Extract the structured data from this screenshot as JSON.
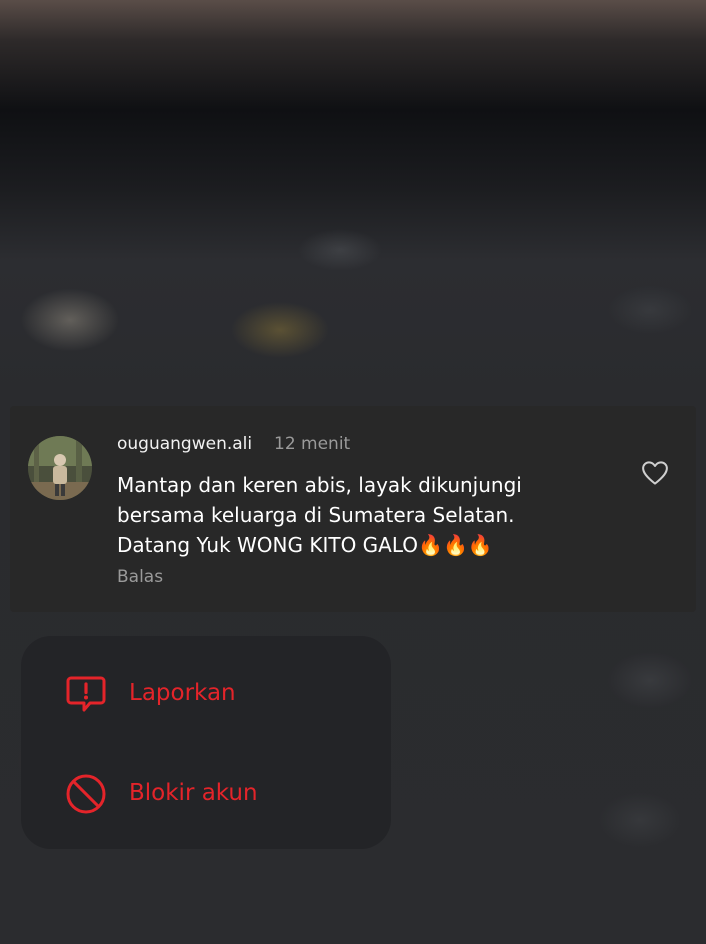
{
  "comment": {
    "username": "ouguangwen.ali",
    "time": "12 menit",
    "text_lines": [
      "Mantap dan keren abis, layak dikunjungi",
      "bersama keluarga di Sumatera Selatan.",
      "Datang Yuk WONG KITO GALO🔥🔥🔥"
    ],
    "reply_label": "Balas",
    "like_icon": "heart-outline-icon"
  },
  "menu": {
    "items": [
      {
        "label": "Laporkan",
        "icon": "report-icon"
      },
      {
        "label": "Blokir akun",
        "icon": "block-icon"
      }
    ]
  },
  "colors": {
    "danger": "#e4242a",
    "card_bg": "#282828",
    "menu_bg": "#232427",
    "muted_text": "#9a9a9a"
  }
}
